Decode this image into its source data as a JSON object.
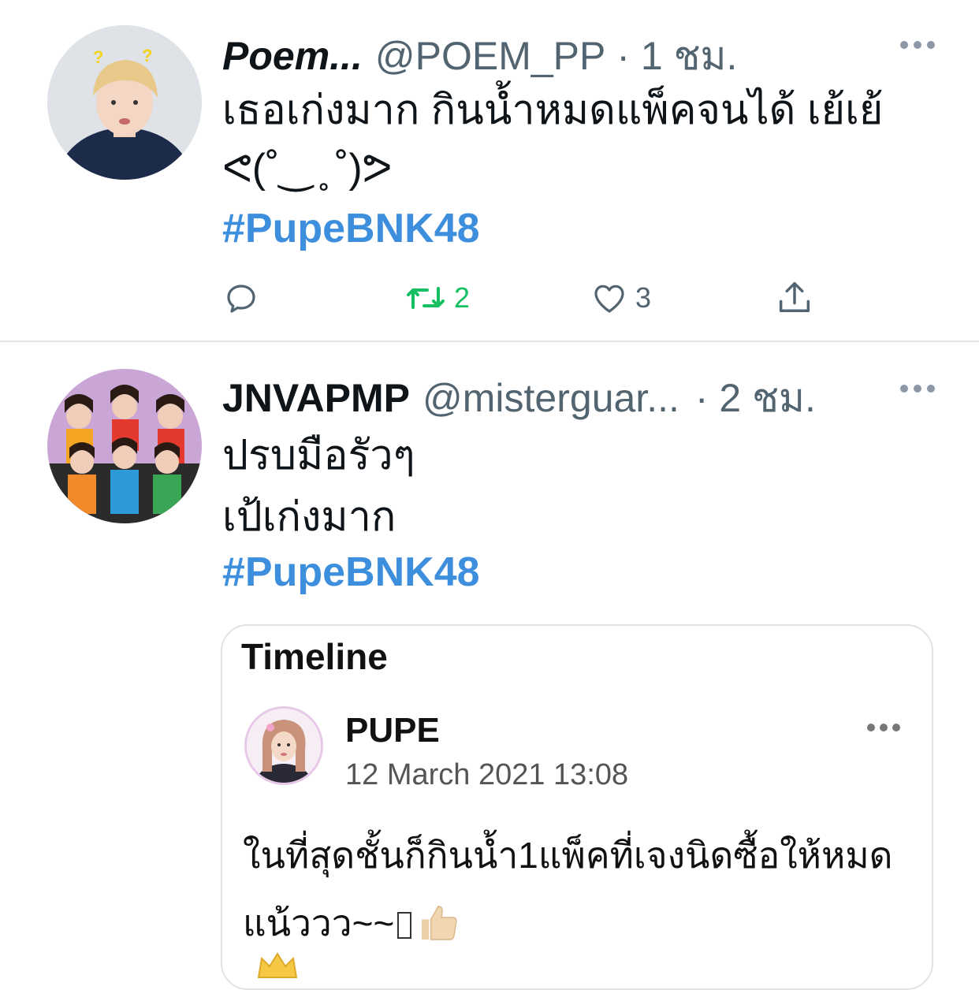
{
  "tweets": [
    {
      "name": "Poem...",
      "handle": "@POEM_PP",
      "time": "· 1 ชม.",
      "text_line1": "เธอเก่งมาก กินน้ำหมดแพ็คจนได้ เย้เย้",
      "text_line2": "ᕙ(˚‿ ̥ ˚)ᕗ",
      "hashtag": "#PupeBNK48",
      "actions": {
        "retweets": "2",
        "likes": "3"
      },
      "accent_retweet": "#17bf63"
    },
    {
      "name": "JNVAPMP",
      "handle": "@misterguar...",
      "time": "· 2 ชม.",
      "text_line1": "ปรบมือรัวๆ",
      "text_line2": "เป้เก่งมาก",
      "hashtag": "#PupeBNK48",
      "card": {
        "title": "Timeline",
        "name": "PUPE",
        "date": "12 March 2021 13:08",
        "text_line1": "ในที่สุดชั้นก็กินน้ำ1แพ็คที่เจงนิดซื้อให้หมด",
        "text_line2": "แน้ววว~~"
      }
    }
  ],
  "colors": {
    "hashtag": "#3d8fde",
    "secondary": "#536471",
    "divider": "#e1e6ea"
  }
}
